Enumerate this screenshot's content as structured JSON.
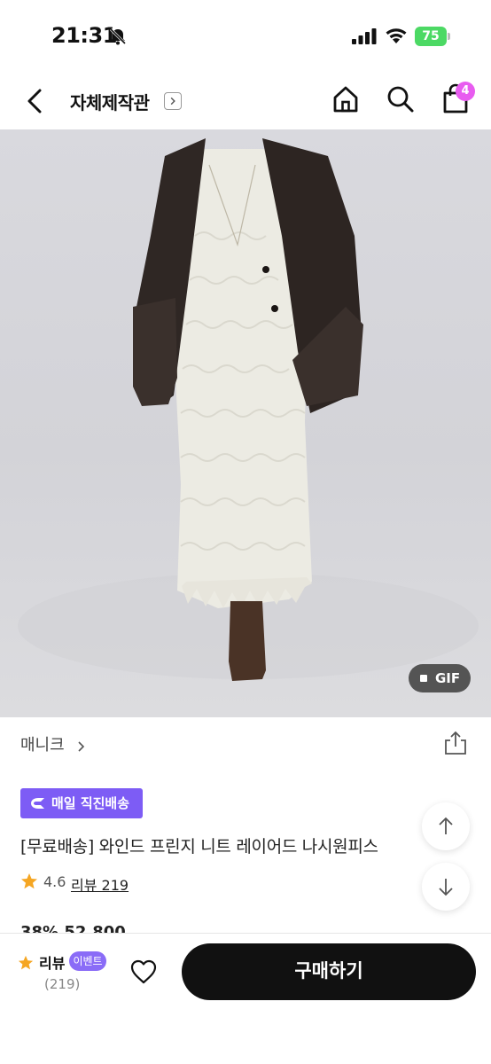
{
  "status_bar": {
    "time": "21:31",
    "battery": "75"
  },
  "header": {
    "shop_title": "자체제작관",
    "cart_count": "4"
  },
  "media": {
    "gif_label": "GIF"
  },
  "product": {
    "brand": "매니크",
    "delivery_badge": "매일 직진배송",
    "title": "[무료배송] 와인드 프린지 니트 레이어드 나시원피스",
    "rating": "4.6",
    "review_link": "리뷰 219",
    "price_peek": "38%  52,800"
  },
  "bottom_bar": {
    "review_label": "리뷰",
    "event_tag": "이벤트",
    "review_count": "(219)",
    "buy_label": "구매하기"
  },
  "colors": {
    "accent_purple": "#7d5cf5",
    "cart_badge": "#e85cf0",
    "star": "#f5a623",
    "buy_button": "#111111"
  }
}
